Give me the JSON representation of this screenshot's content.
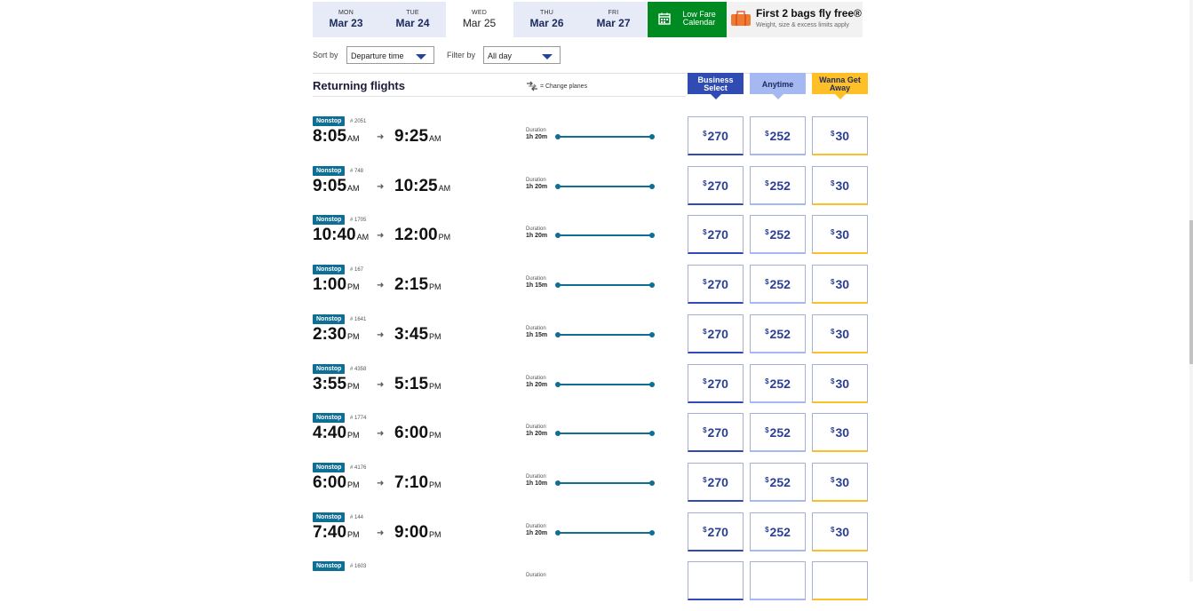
{
  "dates": [
    {
      "dow": "MON",
      "date": "Mar 23"
    },
    {
      "dow": "TUE",
      "date": "Mar 24"
    },
    {
      "dow": "WED",
      "date": "Mar 25"
    },
    {
      "dow": "THU",
      "date": "Mar 26"
    },
    {
      "dow": "FRI",
      "date": "Mar 27"
    }
  ],
  "selected_date_index": 2,
  "low_fare": {
    "line1": "Low Fare",
    "line2": "Calendar"
  },
  "bags": {
    "title": "First 2 bags fly free®",
    "subtitle": "Weight, size & excess limits apply"
  },
  "sort": {
    "label": "Sort by",
    "value": "Departure time"
  },
  "filter": {
    "label": "Filter by",
    "value": "All day"
  },
  "section_title": "Returning flights",
  "change_planes_label": "= Change planes",
  "fare_types": [
    {
      "line1": "Business",
      "line2": "Select",
      "bg": "#304cb2",
      "fg": "#ffffff"
    },
    {
      "line1": "Anytime",
      "line2": "",
      "bg": "#a6b8f1",
      "fg": "#1b2a5e"
    },
    {
      "line1": "Wanna Get",
      "line2": "Away",
      "bg": "#ffbf27",
      "fg": "#1b2a5e"
    }
  ],
  "fare_border_colors": [
    "#304cb2",
    "#a6b8f1",
    "#ffbf27"
  ],
  "currency_symbol": "$",
  "duration_label": "Duration",
  "flights": [
    {
      "badge": "Nonstop",
      "number": "# 2051",
      "dep": "8:05",
      "dep_ampm": "AM",
      "arr": "9:25",
      "arr_ampm": "AM",
      "duration": "1h 20m",
      "fares": [
        "270",
        "252",
        "30"
      ]
    },
    {
      "badge": "Nonstop",
      "number": "# 748",
      "dep": "9:05",
      "dep_ampm": "AM",
      "arr": "10:25",
      "arr_ampm": "AM",
      "duration": "1h 20m",
      "fares": [
        "270",
        "252",
        "30"
      ]
    },
    {
      "badge": "Nonstop",
      "number": "# 1705",
      "dep": "10:40",
      "dep_ampm": "AM",
      "arr": "12:00",
      "arr_ampm": "PM",
      "duration": "1h 20m",
      "fares": [
        "270",
        "252",
        "30"
      ]
    },
    {
      "badge": "Nonstop",
      "number": "# 167",
      "dep": "1:00",
      "dep_ampm": "PM",
      "arr": "2:15",
      "arr_ampm": "PM",
      "duration": "1h 15m",
      "fares": [
        "270",
        "252",
        "30"
      ]
    },
    {
      "badge": "Nonstop",
      "number": "# 1641",
      "dep": "2:30",
      "dep_ampm": "PM",
      "arr": "3:45",
      "arr_ampm": "PM",
      "duration": "1h 15m",
      "fares": [
        "270",
        "252",
        "30"
      ]
    },
    {
      "badge": "Nonstop",
      "number": "# 4358",
      "dep": "3:55",
      "dep_ampm": "PM",
      "arr": "5:15",
      "arr_ampm": "PM",
      "duration": "1h 20m",
      "fares": [
        "270",
        "252",
        "30"
      ]
    },
    {
      "badge": "Nonstop",
      "number": "# 1774",
      "dep": "4:40",
      "dep_ampm": "PM",
      "arr": "6:00",
      "arr_ampm": "PM",
      "duration": "1h 20m",
      "fares": [
        "270",
        "252",
        "30"
      ]
    },
    {
      "badge": "Nonstop",
      "number": "# 4176",
      "dep": "6:00",
      "dep_ampm": "PM",
      "arr": "7:10",
      "arr_ampm": "PM",
      "duration": "1h 10m",
      "fares": [
        "270",
        "252",
        "30"
      ]
    },
    {
      "badge": "Nonstop",
      "number": "# 144",
      "dep": "7:40",
      "dep_ampm": "PM",
      "arr": "9:00",
      "arr_ampm": "PM",
      "duration": "1h 20m",
      "fares": [
        "270",
        "252",
        "30"
      ]
    },
    {
      "badge": "Nonstop",
      "number": "# 1603",
      "dep": "",
      "dep_ampm": "",
      "arr": "",
      "arr_ampm": "",
      "duration": "",
      "fares": [
        "",
        "",
        ""
      ]
    }
  ]
}
